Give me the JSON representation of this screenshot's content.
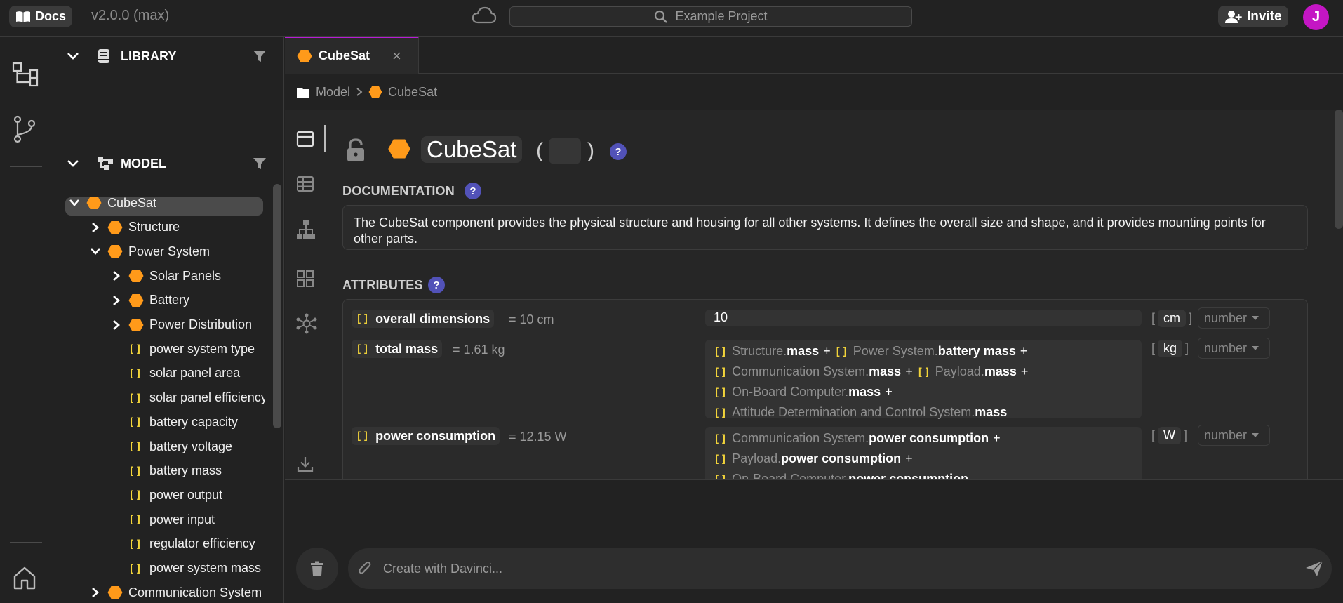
{
  "topbar": {
    "docs_label": "Docs",
    "version": "v2.0.0 (max)",
    "search_placeholder": "Example Project",
    "invite_label": "Invite",
    "avatar_initial": "J"
  },
  "library": {
    "title": "LIBRARY"
  },
  "model": {
    "title": "MODEL",
    "tree": [
      {
        "label": "CubeSat",
        "kind": "component",
        "level": 0,
        "expanded": true,
        "selected": true
      },
      {
        "label": "Structure",
        "kind": "component",
        "level": 1,
        "expanded": false
      },
      {
        "label": "Power System",
        "kind": "component",
        "level": 1,
        "expanded": true
      },
      {
        "label": "Solar Panels",
        "kind": "component",
        "level": 2,
        "expanded": false
      },
      {
        "label": "Battery",
        "kind": "component",
        "level": 2,
        "expanded": false
      },
      {
        "label": "Power Distribution",
        "kind": "component",
        "level": 2,
        "expanded": false
      },
      {
        "label": "power system type",
        "kind": "attribute",
        "level": 2
      },
      {
        "label": "solar panel area",
        "kind": "attribute",
        "level": 2
      },
      {
        "label": "solar panel efficiency",
        "kind": "attribute",
        "level": 2
      },
      {
        "label": "battery capacity",
        "kind": "attribute",
        "level": 2
      },
      {
        "label": "battery voltage",
        "kind": "attribute",
        "level": 2
      },
      {
        "label": "battery mass",
        "kind": "attribute",
        "level": 2
      },
      {
        "label": "power output",
        "kind": "attribute",
        "level": 2
      },
      {
        "label": "power input",
        "kind": "attribute",
        "level": 2
      },
      {
        "label": "regulator efficiency",
        "kind": "attribute",
        "level": 2
      },
      {
        "label": "power system mass",
        "kind": "attribute",
        "level": 2
      },
      {
        "label": "Communication System",
        "kind": "component",
        "level": 1,
        "expanded": false
      }
    ]
  },
  "tab": {
    "label": "CubeSat",
    "close": "×"
  },
  "breadcrumb": {
    "root": "Model",
    "current": "CubeSat"
  },
  "editor": {
    "title": "CubeSat",
    "open_paren": "(",
    "close_paren": ")",
    "help": "?",
    "documentation_label": "DOCUMENTATION",
    "documentation_text": "The CubeSat component provides the physical structure and housing for all other systems. It defines the overall size and shape, and it provides mounting points for other parts.",
    "attributes_label": "ATTRIBUTES",
    "attributes": [
      {
        "name": "overall dimensions",
        "value": "= 10 cm",
        "expression": "10",
        "unit": "cm",
        "type": "number"
      },
      {
        "name": "total mass",
        "value": "= 1.61 kg",
        "terms": [
          {
            "prefix": "Structure.",
            "attr": "mass"
          },
          {
            "prefix": "Power System.",
            "attr": "battery mass"
          },
          {
            "prefix": "Communication System.",
            "attr": "mass"
          },
          {
            "prefix": "Payload.",
            "attr": "mass"
          },
          {
            "prefix": "On-Board Computer.",
            "attr": "mass"
          },
          {
            "prefix": "Attitude Determination and Control System.",
            "attr": "mass"
          }
        ],
        "unit": "kg",
        "type": "number"
      },
      {
        "name": "power consumption",
        "value": "= 12.15 W",
        "terms": [
          {
            "prefix": "Communication System.",
            "attr": "power consumption"
          },
          {
            "prefix": "Payload.",
            "attr": "power consumption"
          },
          {
            "prefix": "On-Board Computer.",
            "attr": "power consumption"
          }
        ],
        "unit": "W",
        "type": "number"
      }
    ]
  },
  "chat": {
    "placeholder": "Create with Davinci..."
  },
  "colors": {
    "accent": "#b81cd6",
    "component": "#ff9a1a",
    "attribute_bracket": "#f2d43a",
    "help": "#5252b8"
  }
}
